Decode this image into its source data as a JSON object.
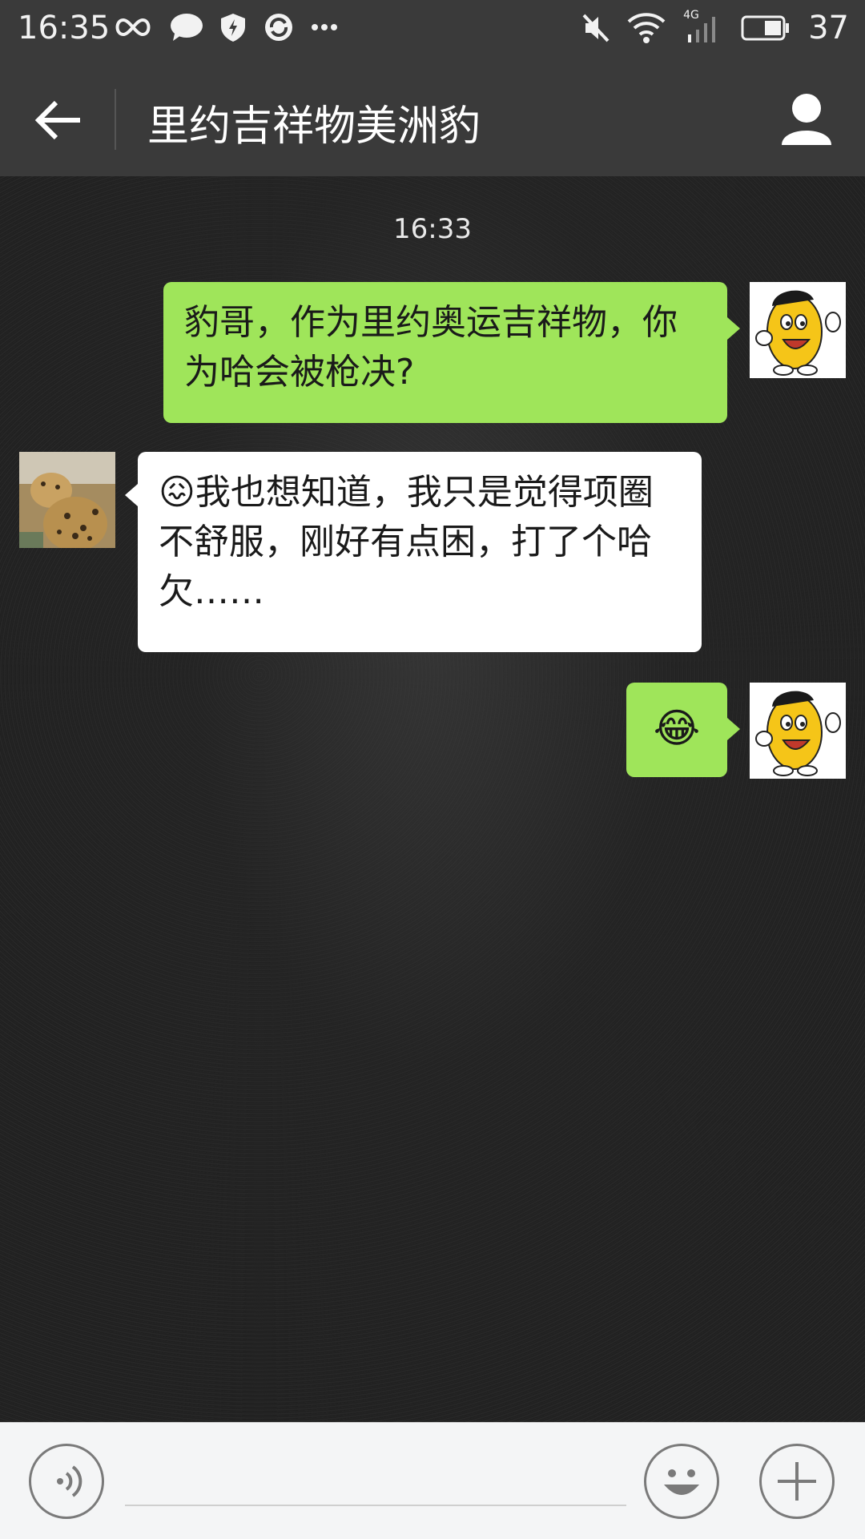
{
  "status_bar": {
    "time": "16:35",
    "battery": "37",
    "network": "4G"
  },
  "header": {
    "title": "里约吉祥物美洲豹"
  },
  "chat": {
    "timestamp": "16:33",
    "messages": [
      {
        "sender": "me",
        "text": "豹哥，作为里约奥运吉祥物，你为哈会被枪决?"
      },
      {
        "sender": "other",
        "emoji": "😖",
        "text": "我也想知道，我只是觉得项圈不舒服，刚好有点困，打了个哈欠……"
      },
      {
        "sender": "me",
        "emoji": "😂"
      }
    ]
  },
  "input": {
    "placeholder": ""
  },
  "colors": {
    "bubble_me": "#9fe55a",
    "bubble_other": "#ffffff",
    "bars": "#3a3a3a"
  }
}
